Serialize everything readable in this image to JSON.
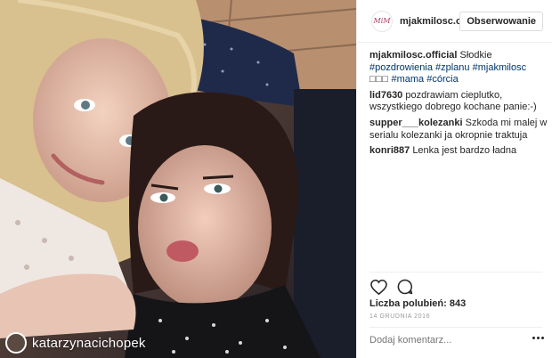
{
  "photo": {
    "repost_name": "katarzynacichopek"
  },
  "header": {
    "logo_text": "MiM",
    "handle": "mjakmilosc.off",
    "follow_label": "Obserwowanie"
  },
  "caption": {
    "user": "mjakmilosc.official",
    "text_before": "Słodkie",
    "tag1": "#pozdrowienia",
    "tag2": "#zplanu",
    "tag3": "#mjakmilosc",
    "boxes": "□□□",
    "tag4": "#mama",
    "tag5": "#córcia"
  },
  "comments": [
    {
      "user": "lid7630",
      "text": "pozdrawiam cieplutko, wszystkiego dobrego kochane panie:-)"
    },
    {
      "user": "supper___kolezanki",
      "text": "Szkoda mi malej w serialu kolezanki ja okropnie traktuja"
    },
    {
      "user": "konri887",
      "text": "Lenka jest bardzo ładna"
    }
  ],
  "likes": "Liczba polubień: 843",
  "date": "14 GRUDNIA 2016",
  "add_comment_placeholder": "Dodaj komentarz...",
  "icons": [
    "heart-icon",
    "comment-icon",
    "more-options-icon"
  ]
}
